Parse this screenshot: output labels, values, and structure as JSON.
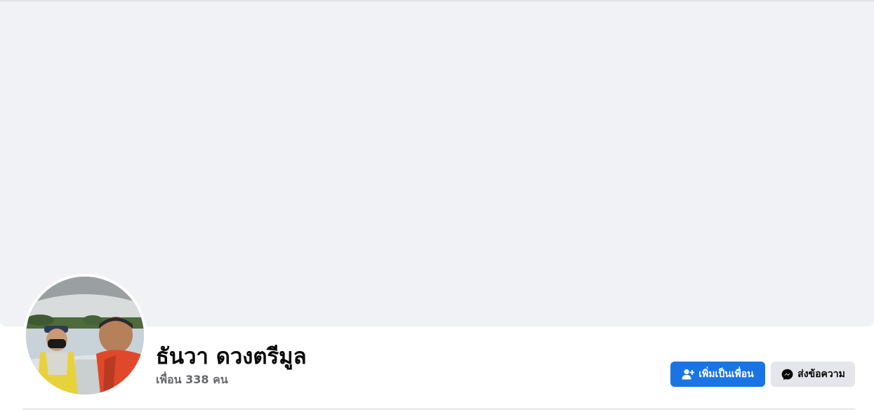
{
  "profile": {
    "name": "ธันวา ดวงตรีมูล",
    "friends_text": "เพื่อน 338 คน"
  },
  "actions": {
    "add_friend_label": "เพิ่มเป็นเพื่อน",
    "message_label": "ส่งข้อความ"
  },
  "colors": {
    "primary_button": "#1b74e4",
    "secondary_button": "#e4e6eb",
    "cover_background": "#f0f2f5",
    "secondary_text": "#65676b"
  },
  "icons": {
    "add_friend": "person-plus-icon",
    "message": "messenger-icon"
  }
}
